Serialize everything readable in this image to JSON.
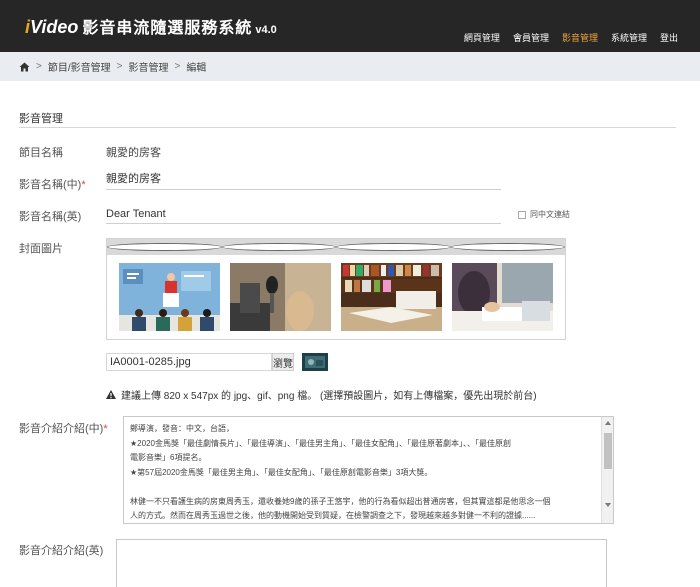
{
  "header": {
    "brand_i": "i",
    "brand_video": "Video",
    "brand_name": "影音串流隨選服務系統",
    "brand_version": "v4.0",
    "nav": [
      {
        "label": "網頁管理",
        "active": false
      },
      {
        "label": "會員管理",
        "active": false
      },
      {
        "label": "影音管理",
        "active": true
      },
      {
        "label": "系統管理",
        "active": false
      },
      {
        "label": "登出",
        "active": false
      }
    ]
  },
  "breadcrumb": {
    "home_icon": "home-icon",
    "items": [
      "節目/影音管理",
      "影音管理",
      "編輯"
    ],
    "separator": ">"
  },
  "form": {
    "section_title": "影音管理",
    "program_name_label": "節目名稱",
    "program_name_value": "親愛的房客",
    "video_name_zh_label": "影音名稱(中)",
    "required_mark": "*",
    "video_name_zh_value": "親愛的房客",
    "video_name_en_label": "影音名稱(英)",
    "video_name_en_value": "Dear Tenant",
    "same_as_zh_checkbox": "同中文連結",
    "cover_label": "封面圖片",
    "cover_images": [
      "presentation-illustration",
      "microphone-photo",
      "bookshelf-photo",
      "writing-desk-photo"
    ],
    "file_name": "IA0001-0285.jpg",
    "browse_label": "瀏覽",
    "hint_icon": "warning-icon",
    "hint_text": "建議上傳 820 x 547px 的 jpg、gif、png 檔。 (選擇預設圖片，如有上傳檔案，優先出現於前台)",
    "intro_zh_label": "影音介紹介紹(中)",
    "intro_zh_lines": [
      "鄭導演，發音：中文，台語，",
      "★2020金馬獎「最佳劇情長片」、「最佳導演」、「最佳男主角」、「最佳女配角」、「最佳原著劇本」、、「最佳原創",
      "電影音樂」6項提名。",
      "★第57屆2020金馬獎「最佳男主角」、「最佳女配角」、「最佳原創電影音樂」3項大獎。",
      "",
      "林健一不只看護生病的房東周秀玉，還收養她9歲的孫子王悠宇，他的行為看似超出普通房客，但其實這都是他思念一個",
      "人的方式。然而在周秀玉過世之後，他的動機開始受到質疑，在檢警調查之下，發現越來越多對健一不利的證據......"
    ],
    "intro_en_label": "影音介紹介紹(英)"
  }
}
